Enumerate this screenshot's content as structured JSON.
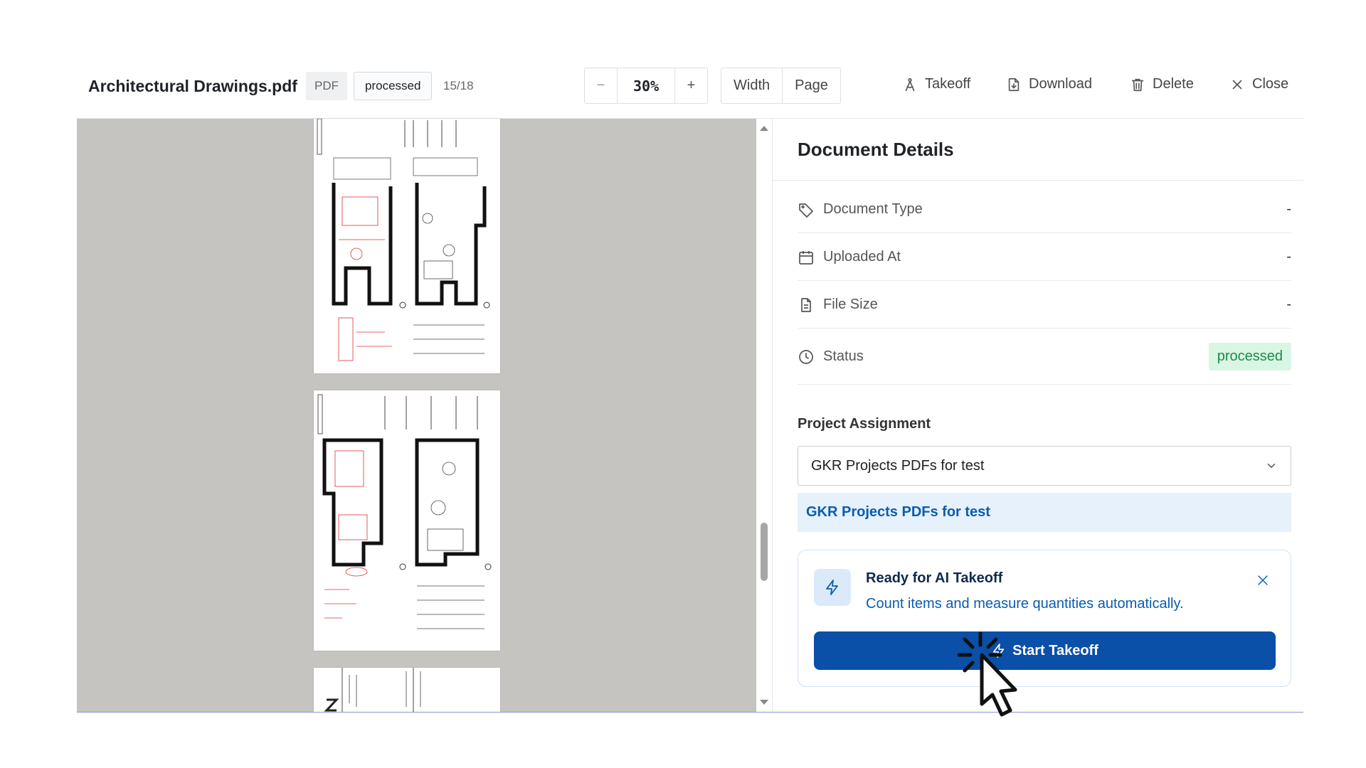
{
  "header": {
    "title": "Architectural Drawings.pdf",
    "file_type": "PDF",
    "status_tag": "processed",
    "page_indicator": "15/18",
    "zoom": {
      "minus": "−",
      "value": "30%",
      "plus": "+"
    },
    "fit": {
      "width_label": "Width",
      "page_label": "Page"
    },
    "actions": {
      "takeoff": "Takeoff",
      "download": "Download",
      "delete": "Delete",
      "close": "Close"
    }
  },
  "panel": {
    "title": "Document Details",
    "details": [
      {
        "icon": "tag-icon",
        "label": "Document Type",
        "value": "-"
      },
      {
        "icon": "calendar-icon",
        "label": "Uploaded At",
        "value": "-"
      },
      {
        "icon": "file-icon",
        "label": "File Size",
        "value": "-"
      },
      {
        "icon": "clock-icon",
        "label": "Status",
        "value": "processed"
      }
    ],
    "project_label": "Project Assignment",
    "project_selected": "GKR Projects PDFs for test",
    "project_option": "GKR Projects PDFs for test",
    "ai_card": {
      "title": "Ready for AI Takeoff",
      "subtitle": "Count items and measure quantities automatically.",
      "button": "Start Takeoff"
    }
  },
  "colors": {
    "primary": "#0a4fa8",
    "status_bg": "#d9f5e4",
    "status_fg": "#1c8a4a",
    "viewer_bg": "#c5c4c1"
  }
}
